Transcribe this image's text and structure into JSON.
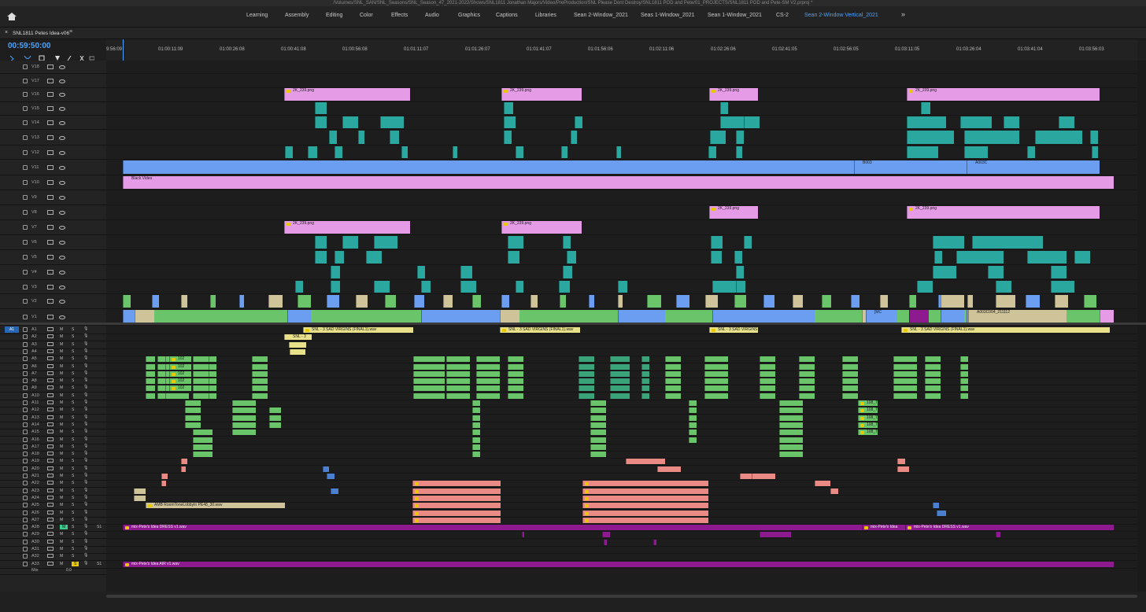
{
  "title_path": "/Volumes/SNL_SAN/SNL_Seasons/SNL_Season_47_2021-2022/Shows/SNL1811 Jonathan Majors/Video/PreProduction/SNL Please Dont Destroy/SNL1811 POD and Pete/01_PROJECTS/SNL1811 POD and Pete-SM V2.prproj *",
  "workspaces": [
    "Learning",
    "Assembly",
    "Editing",
    "Color",
    "Effects",
    "Audio",
    "Graphics",
    "Captions",
    "Libraries",
    "Sean 2-Window_2021",
    "Seas 1-Window_2021",
    "Sean 1-Window_2021",
    "CS-2",
    "Sean 2-Window Vertical_2021"
  ],
  "active_workspace": "Sean 2-Window Vertical_2021",
  "sequence_tab": "SNL1811 Petes Idea-v06",
  "timecode": "00:59:50:00",
  "ruler_ticks": [
    "9:56:09",
    "01:00:11:09",
    "01:00:26:08",
    "01:00:41:08",
    "01:00:56:08",
    "01:01:11:07",
    "01:01:26:07",
    "01:01:41:07",
    "01:01:56:06",
    "01:02:11:06",
    "01:02:26:06",
    "01:02:41:05",
    "01:02:56:05",
    "01:03:11:05",
    "01:03:26:04",
    "01:03:41:04",
    "01:03:56:03"
  ],
  "video_tracks": [
    "V18",
    "V17",
    "V16",
    "V15",
    "V14",
    "V13",
    "V12",
    "V11",
    "V10",
    "V9",
    "V8",
    "V7",
    "V6",
    "V5",
    "V4",
    "V3",
    "V2",
    "V1"
  ],
  "audio_tracks": [
    "A1",
    "A2",
    "A3",
    "A4",
    "A5",
    "A6",
    "A7",
    "A8",
    "A9",
    "A10",
    "A11",
    "A12",
    "A13",
    "A14",
    "A15",
    "A16",
    "A17",
    "A18",
    "A19",
    "A20",
    "A21",
    "A22",
    "A23",
    "A24",
    "A25",
    "A26",
    "A27",
    "A28",
    "A29",
    "A30",
    "A31",
    "A32",
    "A33"
  ],
  "mix_label": "Mix",
  "mix_value": "0.0",
  "source_patch": "A1",
  "m_label": "M",
  "s_label": "S",
  "s1_label": "S1",
  "clip_labels": {
    "png": "2K_239.png",
    "black_video": "Black Video",
    "snl_wav": "SNL - 3 SAD VIRGINS (FINAL1).wav",
    "snl_short": "SNL - 3",
    "amb": "AMB RoomToneLobbyIn PE48_30.wav",
    "mix_dress": "mix-Pete's Idea DRESS v1.wav",
    "mix_dress_short": "mix-Pete's Idea",
    "mix_air": "mix-Pete's Idea AIR v1.wav",
    "b003": "B003",
    "a003c": "A003C",
    "mc": "[MC",
    "a003c004": "A003C004_211112",
    "clip102": "102",
    "clip108": "108_T"
  },
  "colors": {
    "accent": "#4aa3ff",
    "pink": "#e59be6",
    "blue": "#6b9ef0",
    "green": "#6ac469",
    "teal": "#2aa8a0",
    "yellow": "#e8e18a",
    "purple": "#8d1a8f",
    "salmon": "#e98a84",
    "tan": "#cfc39a"
  }
}
